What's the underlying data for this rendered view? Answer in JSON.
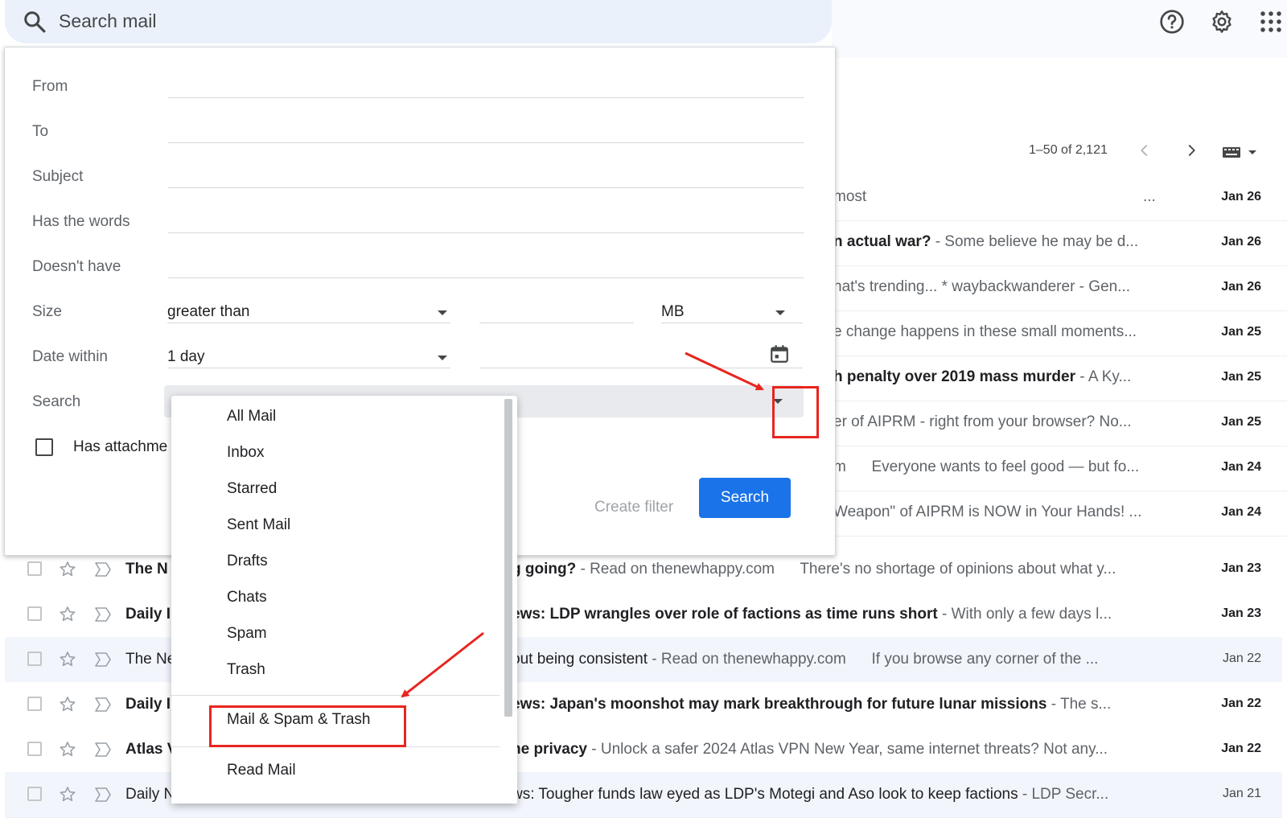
{
  "topbar": {
    "search_placeholder": "Search mail",
    "icons": [
      "search-icon",
      "help-icon",
      "settings-icon",
      "apps-grid-icon"
    ]
  },
  "pager": {
    "text": "1–50 of 2,121"
  },
  "search_panel": {
    "labels": {
      "from": "From",
      "to": "To",
      "subject": "Subject",
      "has_words": "Has the words",
      "doesnt_have": "Doesn't have",
      "size": "Size",
      "date_within": "Date within",
      "search": "Search",
      "has_attachment": "Has attachme"
    },
    "size_operator": "greater than",
    "size_unit": "MB",
    "date_range": "1 day",
    "create_filter": "Create filter",
    "search_button": "Search"
  },
  "dropdown": {
    "items": [
      "All Mail",
      "Inbox",
      "Starred",
      "Sent Mail",
      "Drafts",
      "Chats",
      "Spam",
      "Trash",
      "Mail & Spam & Trash",
      "Read Mail"
    ]
  },
  "right_rows": [
    {
      "content": "most",
      "snippet": "...",
      "date": "Jan 26"
    },
    {
      "subject": "n actual war?",
      "snippet": " - Some believe he may be d...",
      "date": "Jan 26"
    },
    {
      "content": "nat's trending... * waybackwanderer - Gen...",
      "date": "Jan 26"
    },
    {
      "content": "e change happens in these small moments...",
      "date": "Jan 25"
    },
    {
      "subject": "h penalty over 2019 mass murder",
      "snippet": " - A Ky...",
      "date": "Jan 25"
    },
    {
      "content": "er of AIPRM - right from your browser? No...",
      "date": "Jan 25"
    },
    {
      "content": "m      Everyone wants to feel good — but fo...",
      "date": "Jan 24"
    },
    {
      "content": "Weapon\" of AIPRM is NOW in Your Hands! ...",
      "date": "Jan 24"
    }
  ],
  "mail_rows": [
    {
      "sender": "The N",
      "subject": "g going?",
      "snippet": " - Read on thenewhappy.com      There's no shortage of opinions about what y...",
      "date": "Jan 23",
      "state": "unread"
    },
    {
      "sender": "Daily I",
      "subject": "ews: LDP wrangles over role of factions as time runs short",
      "snippet": " - With only a few days l...",
      "date": "Jan 23",
      "state": "unread"
    },
    {
      "sender": "The Ne",
      "subject": "out being consistent",
      "snippet": " - Read on thenewhappy.com      If you browse any corner of the ...",
      "date": "Jan 22",
      "state": "read"
    },
    {
      "sender": "Daily I",
      "subject": "ews: Japan's moonshot may mark breakthrough for future lunar missions",
      "snippet": " - The s...",
      "date": "Jan 22",
      "state": "unread"
    },
    {
      "sender": "Atlas V",
      "subject": "ne privacy",
      "snippet": " - Unlock a safer 2024 Atlas VPN New Year, same internet threats? Not any...",
      "date": "Jan 22",
      "state": "unread"
    },
    {
      "sender": "Daily N",
      "subject": "ws: Tougher funds law eyed as LDP's Motegi and Aso look to keep factions",
      "snippet": " - LDP Secr...",
      "date": "Jan 21",
      "state": "read"
    }
  ],
  "colors": {
    "accent": "#1a73e8",
    "annotation": "#e8251f",
    "search_bar": "#eaf1fb"
  }
}
